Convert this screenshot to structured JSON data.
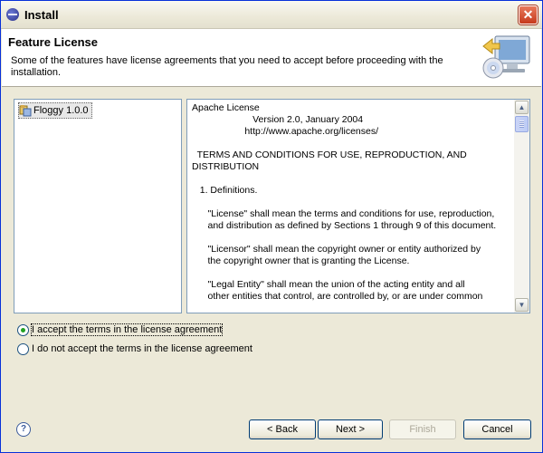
{
  "window": {
    "title": "Install",
    "close_glyph": "✕"
  },
  "header": {
    "title": "Feature License",
    "description": "Some of the features have license agreements that you need to accept before proceeding with the installation.",
    "graphic_icon": "install-monitor-cd-icon"
  },
  "features": [
    {
      "label": "Floggy 1.0.0",
      "icon": "feature-icon"
    }
  ],
  "license": {
    "text": "Apache License\n                       Version 2.0, January 2004\n                    http://www.apache.org/licenses/\n\n  TERMS AND CONDITIONS FOR USE, REPRODUCTION, AND\nDISTRIBUTION\n\n   1. Definitions.\n\n      \"License\" shall mean the terms and conditions for use, reproduction,\n      and distribution as defined by Sections 1 through 9 of this document.\n\n      \"Licensor\" shall mean the copyright owner or entity authorized by\n      the copyright owner that is granting the License.\n\n      \"Legal Entity\" shall mean the union of the acting entity and all\n      other entities that control, are controlled by, or are under common"
  },
  "options": {
    "accept": {
      "label": "I accept the terms in the license agreement",
      "selected": true
    },
    "decline": {
      "label": "I do not accept the terms in the license agreement",
      "selected": false
    }
  },
  "buttons": {
    "help": "?",
    "back": "< Back",
    "next": "Next >",
    "finish": "Finish",
    "cancel": "Cancel"
  },
  "colors": {
    "accent": "#0831d9",
    "radio_dot": "#21a121"
  }
}
